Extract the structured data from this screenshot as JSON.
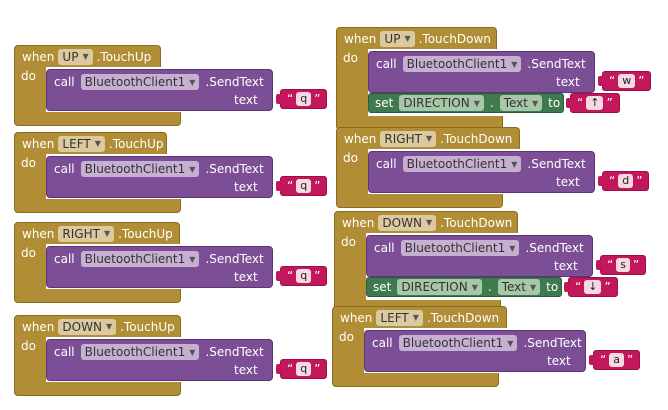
{
  "labels": {
    "when": "when",
    "do": "do",
    "call": "call",
    "text": "text",
    "set": "set",
    "to": "to",
    "dot": ".",
    "quote_open": "“",
    "quote_close": "”"
  },
  "events": [
    {
      "id": "up_touchup",
      "component": "UP",
      "event": ".TouchUp",
      "target": "BluetoothClient1",
      "method": ".SendText",
      "value": "q",
      "set": null
    },
    {
      "id": "left_touchup",
      "component": "LEFT",
      "event": ".TouchUp",
      "target": "BluetoothClient1",
      "method": ".SendText",
      "value": "q",
      "set": null
    },
    {
      "id": "right_touchup",
      "component": "RIGHT",
      "event": ".TouchUp",
      "target": "BluetoothClient1",
      "method": ".SendText",
      "value": "q",
      "set": null
    },
    {
      "id": "down_touchup",
      "component": "DOWN",
      "event": ".TouchUp",
      "target": "BluetoothClient1",
      "method": ".SendText",
      "value": "q",
      "set": null
    },
    {
      "id": "up_touchdown",
      "component": "UP",
      "event": ".TouchDown",
      "target": "BluetoothClient1",
      "method": ".SendText",
      "value": "w",
      "set": {
        "component": "DIRECTION",
        "property": "Text",
        "value": "↑"
      }
    },
    {
      "id": "right_touchdown",
      "component": "RIGHT",
      "event": ".TouchDown",
      "target": "BluetoothClient1",
      "method": ".SendText",
      "value": "d",
      "set": null
    },
    {
      "id": "down_touchdown",
      "component": "DOWN",
      "event": ".TouchDown",
      "target": "BluetoothClient1",
      "method": ".SendText",
      "value": "s",
      "set": {
        "component": "DIRECTION",
        "property": "Text",
        "value": "↓"
      }
    },
    {
      "id": "left_touchdown",
      "component": "LEFT",
      "event": ".TouchDown",
      "target": "BluetoothClient1",
      "method": ".SendText",
      "value": "a",
      "set": null
    }
  ],
  "colors": {
    "event_block": "#b18e35",
    "call_block": "#7b4e95",
    "set_block": "#3f7a4f",
    "string_block": "#c2185b"
  },
  "icons": {
    "dropdown": "triangle-down-icon"
  }
}
